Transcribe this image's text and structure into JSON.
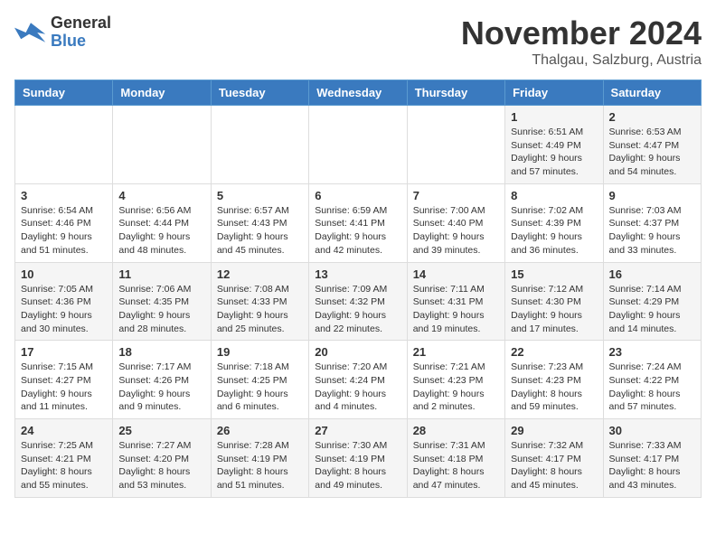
{
  "header": {
    "logo_line1": "General",
    "logo_line2": "Blue",
    "month": "November 2024",
    "location": "Thalgau, Salzburg, Austria"
  },
  "weekdays": [
    "Sunday",
    "Monday",
    "Tuesday",
    "Wednesday",
    "Thursday",
    "Friday",
    "Saturday"
  ],
  "weeks": [
    [
      {
        "day": "",
        "info": ""
      },
      {
        "day": "",
        "info": ""
      },
      {
        "day": "",
        "info": ""
      },
      {
        "day": "",
        "info": ""
      },
      {
        "day": "",
        "info": ""
      },
      {
        "day": "1",
        "info": "Sunrise: 6:51 AM\nSunset: 4:49 PM\nDaylight: 9 hours and 57 minutes."
      },
      {
        "day": "2",
        "info": "Sunrise: 6:53 AM\nSunset: 4:47 PM\nDaylight: 9 hours and 54 minutes."
      }
    ],
    [
      {
        "day": "3",
        "info": "Sunrise: 6:54 AM\nSunset: 4:46 PM\nDaylight: 9 hours and 51 minutes."
      },
      {
        "day": "4",
        "info": "Sunrise: 6:56 AM\nSunset: 4:44 PM\nDaylight: 9 hours and 48 minutes."
      },
      {
        "day": "5",
        "info": "Sunrise: 6:57 AM\nSunset: 4:43 PM\nDaylight: 9 hours and 45 minutes."
      },
      {
        "day": "6",
        "info": "Sunrise: 6:59 AM\nSunset: 4:41 PM\nDaylight: 9 hours and 42 minutes."
      },
      {
        "day": "7",
        "info": "Sunrise: 7:00 AM\nSunset: 4:40 PM\nDaylight: 9 hours and 39 minutes."
      },
      {
        "day": "8",
        "info": "Sunrise: 7:02 AM\nSunset: 4:39 PM\nDaylight: 9 hours and 36 minutes."
      },
      {
        "day": "9",
        "info": "Sunrise: 7:03 AM\nSunset: 4:37 PM\nDaylight: 9 hours and 33 minutes."
      }
    ],
    [
      {
        "day": "10",
        "info": "Sunrise: 7:05 AM\nSunset: 4:36 PM\nDaylight: 9 hours and 30 minutes."
      },
      {
        "day": "11",
        "info": "Sunrise: 7:06 AM\nSunset: 4:35 PM\nDaylight: 9 hours and 28 minutes."
      },
      {
        "day": "12",
        "info": "Sunrise: 7:08 AM\nSunset: 4:33 PM\nDaylight: 9 hours and 25 minutes."
      },
      {
        "day": "13",
        "info": "Sunrise: 7:09 AM\nSunset: 4:32 PM\nDaylight: 9 hours and 22 minutes."
      },
      {
        "day": "14",
        "info": "Sunrise: 7:11 AM\nSunset: 4:31 PM\nDaylight: 9 hours and 19 minutes."
      },
      {
        "day": "15",
        "info": "Sunrise: 7:12 AM\nSunset: 4:30 PM\nDaylight: 9 hours and 17 minutes."
      },
      {
        "day": "16",
        "info": "Sunrise: 7:14 AM\nSunset: 4:29 PM\nDaylight: 9 hours and 14 minutes."
      }
    ],
    [
      {
        "day": "17",
        "info": "Sunrise: 7:15 AM\nSunset: 4:27 PM\nDaylight: 9 hours and 11 minutes."
      },
      {
        "day": "18",
        "info": "Sunrise: 7:17 AM\nSunset: 4:26 PM\nDaylight: 9 hours and 9 minutes."
      },
      {
        "day": "19",
        "info": "Sunrise: 7:18 AM\nSunset: 4:25 PM\nDaylight: 9 hours and 6 minutes."
      },
      {
        "day": "20",
        "info": "Sunrise: 7:20 AM\nSunset: 4:24 PM\nDaylight: 9 hours and 4 minutes."
      },
      {
        "day": "21",
        "info": "Sunrise: 7:21 AM\nSunset: 4:23 PM\nDaylight: 9 hours and 2 minutes."
      },
      {
        "day": "22",
        "info": "Sunrise: 7:23 AM\nSunset: 4:23 PM\nDaylight: 8 hours and 59 minutes."
      },
      {
        "day": "23",
        "info": "Sunrise: 7:24 AM\nSunset: 4:22 PM\nDaylight: 8 hours and 57 minutes."
      }
    ],
    [
      {
        "day": "24",
        "info": "Sunrise: 7:25 AM\nSunset: 4:21 PM\nDaylight: 8 hours and 55 minutes."
      },
      {
        "day": "25",
        "info": "Sunrise: 7:27 AM\nSunset: 4:20 PM\nDaylight: 8 hours and 53 minutes."
      },
      {
        "day": "26",
        "info": "Sunrise: 7:28 AM\nSunset: 4:19 PM\nDaylight: 8 hours and 51 minutes."
      },
      {
        "day": "27",
        "info": "Sunrise: 7:30 AM\nSunset: 4:19 PM\nDaylight: 8 hours and 49 minutes."
      },
      {
        "day": "28",
        "info": "Sunrise: 7:31 AM\nSunset: 4:18 PM\nDaylight: 8 hours and 47 minutes."
      },
      {
        "day": "29",
        "info": "Sunrise: 7:32 AM\nSunset: 4:17 PM\nDaylight: 8 hours and 45 minutes."
      },
      {
        "day": "30",
        "info": "Sunrise: 7:33 AM\nSunset: 4:17 PM\nDaylight: 8 hours and 43 minutes."
      }
    ]
  ]
}
